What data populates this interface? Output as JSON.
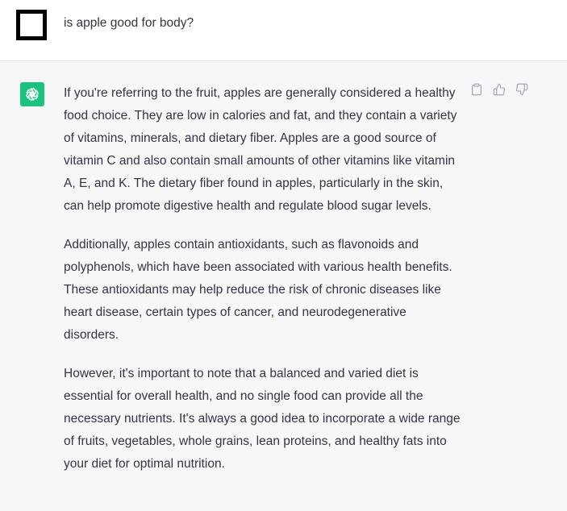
{
  "user_message": {
    "text": "is apple good for body?"
  },
  "assistant_message": {
    "paragraphs": [
      "If you're referring to the fruit, apples are generally considered a healthy food choice. They are low in calories and fat, and they contain a variety of vitamins, minerals, and dietary fiber. Apples are a good source of vitamin C and also contain small amounts of other vitamins like vitamin A, E, and K. The dietary fiber found in apples, particularly in the skin, can help promote digestive health and regulate blood sugar levels.",
      "Additionally, apples contain antioxidants, such as flavonoids and polyphenols, which have been associated with various health benefits. These antioxidants may help reduce the risk of chronic diseases like heart disease, certain types of cancer, and neurodegenerative disorders.",
      "However, it's important to note that a balanced and varied diet is essential for overall health, and no single food can provide all the necessary nutrients. It's always a good idea to incorporate a wide range of fruits, vegetables, whole grains, lean proteins, and healthy fats into your diet for optimal nutrition."
    ],
    "actions": [
      {
        "icon": "clipboard-icon"
      },
      {
        "icon": "thumbs-up-icon"
      },
      {
        "icon": "thumbs-down-icon"
      }
    ]
  },
  "colors": {
    "assistant_background": "#f7f7f8",
    "bot_avatar": "#19c37d",
    "text": "#343541",
    "icon": "#acacbe"
  }
}
